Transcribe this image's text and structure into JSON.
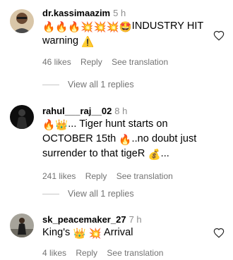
{
  "comments": [
    {
      "username": "dr.kassimaazim",
      "time": "5 h",
      "emojis_before": [
        "fire",
        "fire",
        "fire",
        "collision",
        "collision",
        "collision",
        "star-struck"
      ],
      "text_part1": "INDUSTRY HIT",
      "text_part2": "warning",
      "emoji_after": "warning",
      "likes": "46 likes",
      "reply": "Reply",
      "translate": "See translation"
    },
    {
      "username": "rahul___raj__02",
      "time": "8 h",
      "line1_text": "... Tiger hunt starts on",
      "line2_text": "OCTOBER 15th",
      "line2_text_b": "..no doubt just",
      "line3_text": "surrender to that tigeR",
      "line3_text_b": "...",
      "likes": "241 likes",
      "reply": "Reply",
      "translate": "See translation"
    },
    {
      "username": "sk_peacemaker_27",
      "time": "7 h",
      "text_part1": "King's",
      "text_part2": "Arrival",
      "likes": "4 likes",
      "reply": "Reply",
      "translate": "See translation"
    }
  ],
  "view_replies_1": "View all 1 replies",
  "view_replies_2": "View all 1 replies"
}
